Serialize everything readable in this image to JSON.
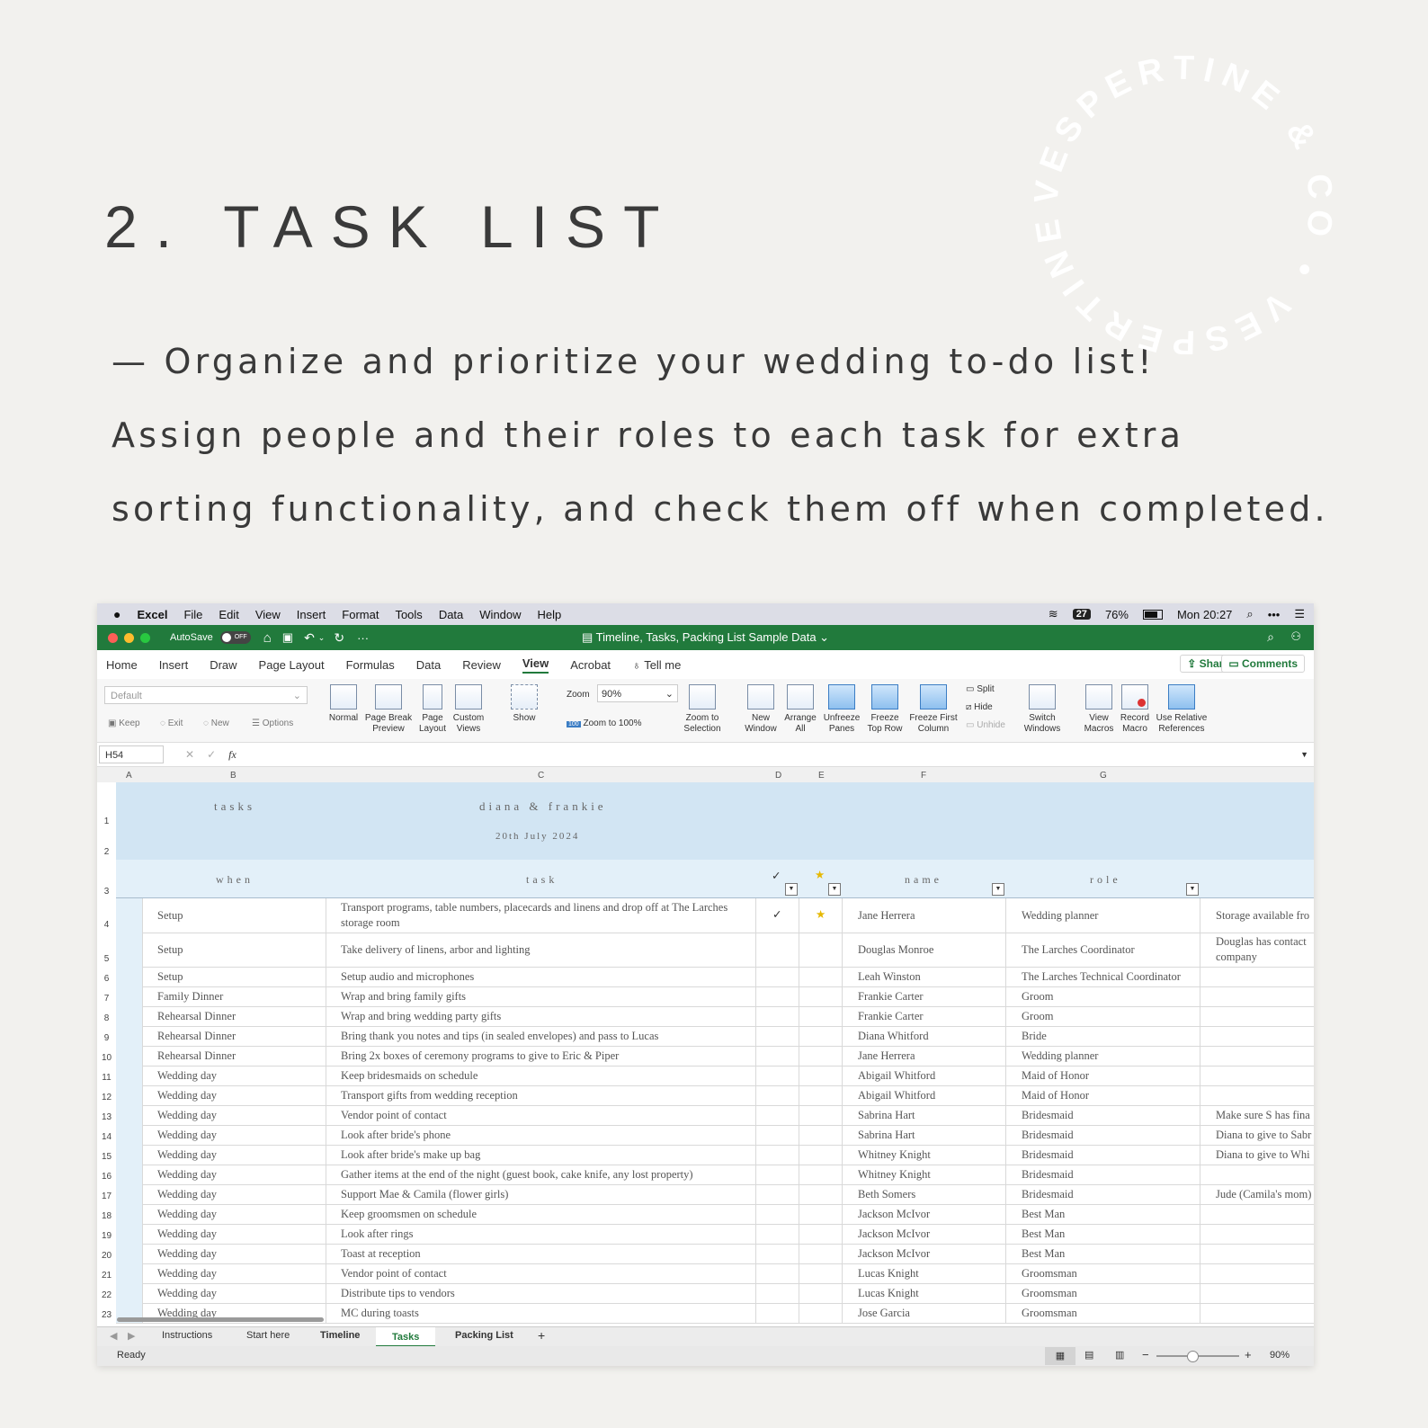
{
  "title": "2. TASK LIST",
  "description": [
    "— Organize and prioritize your wedding to-do list!",
    "Assign people and their roles to each task for extra",
    "sorting functionality, and check them off when completed."
  ],
  "seal_text": "VESPERTINE & CO • VESPERTINE & CO •",
  "menubar": {
    "app": "Excel",
    "items": [
      "File",
      "Edit",
      "View",
      "Insert",
      "Format",
      "Tools",
      "Data",
      "Window",
      "Help"
    ],
    "calendar_badge": "27",
    "battery": "76%",
    "clock": "Mon 20:27"
  },
  "titlebar": {
    "autosave": "AutoSave",
    "autosave_state": "OFF",
    "document": "Timeline, Tasks, Packing List Sample Data"
  },
  "ribbon_tabs": {
    "items": [
      "Home",
      "Insert",
      "Draw",
      "Page Layout",
      "Formulas",
      "Data",
      "Review",
      "View",
      "Acrobat"
    ],
    "active": "View",
    "tell_me": "Tell me",
    "share": "Share",
    "comments": "Comments"
  },
  "ribbon": {
    "sheet_view": "Default",
    "keep": "Keep",
    "exit": "Exit",
    "new": "New",
    "options": "Options",
    "normal": "Normal",
    "page_break": "Page Break Preview",
    "page_layout": "Page Layout",
    "custom_views": "Custom Views",
    "show": "Show",
    "zoom_label": "Zoom",
    "zoom_value": "90%",
    "zoom_100": "Zoom to 100%",
    "zoom_100_badge": "100",
    "zoom_selection": "Zoom to Selection",
    "new_window": "New Window",
    "arrange_all": "Arrange All",
    "unfreeze": "Unfreeze Panes",
    "freeze_top": "Freeze Top Row",
    "freeze_first": "Freeze First Column",
    "split": "Split",
    "hide": "Hide",
    "unhide": "Unhide",
    "switch_windows": "Switch Windows",
    "view_macros": "View Macros",
    "record_macro": "Record Macro",
    "relative_refs": "Use Relative References"
  },
  "formula_bar": {
    "cell": "H54",
    "fx": "fx"
  },
  "columns": [
    "A",
    "B",
    "C",
    "D",
    "E",
    "F",
    "G"
  ],
  "sheet": {
    "banner_left": "tasks",
    "banner_center": "diana & frankie",
    "banner_date": "20th July 2024",
    "headers": {
      "when": "when",
      "task": "task",
      "check": "✓",
      "star": "★",
      "name": "name",
      "role": "role"
    }
  },
  "rows": [
    {
      "num": "4",
      "when": "Setup",
      "task": "Transport programs, table numbers, placecards and linens and drop off at The Larches",
      "task2": "storage room",
      "check": "✓",
      "star": "★",
      "name": "Jane Herrera",
      "role": "Wedding planner",
      "note": "Storage available fro",
      "note2": ""
    },
    {
      "num": "5",
      "when": "Setup",
      "task": "Take delivery of linens, arbor and lighting",
      "task2": "",
      "check": "",
      "star": "",
      "name": "Douglas Monroe",
      "role": "The Larches Coordinator",
      "note": "Douglas has contact",
      "note2": "company"
    },
    {
      "num": "6",
      "when": "Setup",
      "task": "Setup audio and microphones",
      "task2": "",
      "check": "",
      "star": "",
      "name": "Leah Winston",
      "role": "The Larches Technical Coordinator",
      "note": "",
      "note2": ""
    },
    {
      "num": "7",
      "when": "Family Dinner",
      "task": "Wrap and bring family gifts",
      "task2": "",
      "check": "",
      "star": "",
      "name": "Frankie Carter",
      "role": "Groom",
      "note": "",
      "note2": ""
    },
    {
      "num": "8",
      "when": "Rehearsal Dinner",
      "task": "Wrap and bring wedding party gifts",
      "task2": "",
      "check": "",
      "star": "",
      "name": "Frankie Carter",
      "role": "Groom",
      "note": "",
      "note2": ""
    },
    {
      "num": "9",
      "when": "Rehearsal Dinner",
      "task": "Bring thank you notes and tips (in sealed envelopes) and pass to Lucas",
      "task2": "",
      "check": "",
      "star": "",
      "name": "Diana Whitford",
      "role": "Bride",
      "note": "",
      "note2": ""
    },
    {
      "num": "10",
      "when": "Rehearsal Dinner",
      "task": "Bring 2x boxes of ceremony programs to give to Eric & Piper",
      "task2": "",
      "check": "",
      "star": "",
      "name": "Jane Herrera",
      "role": "Wedding planner",
      "note": "",
      "note2": ""
    },
    {
      "num": "11",
      "when": "Wedding day",
      "task": "Keep bridesmaids on schedule",
      "task2": "",
      "check": "",
      "star": "",
      "name": "Abigail Whitford",
      "role": "Maid of Honor",
      "note": "",
      "note2": ""
    },
    {
      "num": "12",
      "when": "Wedding day",
      "task": "Transport gifts from wedding reception",
      "task2": "",
      "check": "",
      "star": "",
      "name": "Abigail Whitford",
      "role": "Maid of Honor",
      "note": "",
      "note2": ""
    },
    {
      "num": "13",
      "when": "Wedding day",
      "task": "Vendor point of contact",
      "task2": "",
      "check": "",
      "star": "",
      "name": "Sabrina Hart",
      "role": "Bridesmaid",
      "note": "Make sure S has fina",
      "note2": ""
    },
    {
      "num": "14",
      "when": "Wedding day",
      "task": "Look after bride's phone",
      "task2": "",
      "check": "",
      "star": "",
      "name": "Sabrina Hart",
      "role": "Bridesmaid",
      "note": "Diana to give to Sabr",
      "note2": ""
    },
    {
      "num": "15",
      "when": "Wedding day",
      "task": "Look after bride's make up bag",
      "task2": "",
      "check": "",
      "star": "",
      "name": "Whitney Knight",
      "role": "Bridesmaid",
      "note": "Diana to give to Whi",
      "note2": ""
    },
    {
      "num": "16",
      "when": "Wedding day",
      "task": "Gather items at the end of the night (guest book, cake knife, any lost property)",
      "task2": "",
      "check": "",
      "star": "",
      "name": "Whitney Knight",
      "role": "Bridesmaid",
      "note": "",
      "note2": ""
    },
    {
      "num": "17",
      "when": "Wedding day",
      "task": "Support Mae & Camila (flower girls)",
      "task2": "",
      "check": "",
      "star": "",
      "name": "Beth Somers",
      "role": "Bridesmaid",
      "note": "Jude (Camila's mom)",
      "note2": ""
    },
    {
      "num": "18",
      "when": "Wedding day",
      "task": "Keep groomsmen on schedule",
      "task2": "",
      "check": "",
      "star": "",
      "name": "Jackson McIvor",
      "role": "Best Man",
      "note": "",
      "note2": ""
    },
    {
      "num": "19",
      "when": "Wedding day",
      "task": "Look after rings",
      "task2": "",
      "check": "",
      "star": "",
      "name": "Jackson McIvor",
      "role": "Best Man",
      "note": "",
      "note2": ""
    },
    {
      "num": "20",
      "when": "Wedding day",
      "task": "Toast at reception",
      "task2": "",
      "check": "",
      "star": "",
      "name": "Jackson McIvor",
      "role": "Best Man",
      "note": "",
      "note2": ""
    },
    {
      "num": "21",
      "when": "Wedding day",
      "task": "Vendor point of contact",
      "task2": "",
      "check": "",
      "star": "",
      "name": "Lucas Knight",
      "role": "Groomsman",
      "note": "",
      "note2": ""
    },
    {
      "num": "22",
      "when": "Wedding day",
      "task": "Distribute tips to vendors",
      "task2": "",
      "check": "",
      "star": "",
      "name": "Lucas Knight",
      "role": "Groomsman",
      "note": "",
      "note2": ""
    },
    {
      "num": "23",
      "when": "Wedding day",
      "task": "MC during toasts",
      "task2": "",
      "check": "",
      "star": "",
      "name": "Jose Garcia",
      "role": "Groomsman",
      "note": "",
      "note2": ""
    }
  ],
  "row_header_nums": [
    "1",
    "2",
    "3"
  ],
  "sheet_tabs": {
    "items": [
      "Instructions",
      "Start here",
      "Timeline",
      "Tasks",
      "Packing List"
    ],
    "active": "Tasks",
    "add": "+"
  },
  "status": {
    "text": "Ready",
    "zoom": "90%"
  },
  "colors": {
    "excel_green": "#217a3c",
    "banner_blue": "#d2e5f3",
    "header_blue": "#e3f0f9",
    "star_gold": "#e6b800"
  }
}
